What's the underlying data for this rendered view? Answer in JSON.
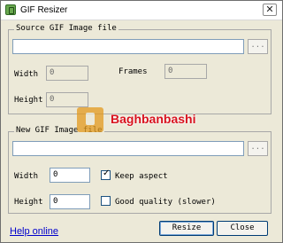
{
  "window": {
    "title": "GIF Resizer",
    "close_glyph": "✕"
  },
  "source_group": {
    "title": "Source GIF Image file",
    "path_value": "",
    "browse_label": "...",
    "width_label": "Width",
    "width_value": "0",
    "height_label": "Height",
    "height_value": "0",
    "frames_label": "Frames",
    "frames_value": "0"
  },
  "new_group": {
    "title": "New GIF Image file",
    "path_value": "",
    "browse_label": "...",
    "width_label": "Width",
    "width_value": "0",
    "height_label": "Height",
    "height_value": "0",
    "keep_aspect_label": "Keep aspect",
    "keep_aspect_checked": true,
    "check_glyph": "✓",
    "good_quality_label": "Good quality (slower)",
    "good_quality_checked": false
  },
  "buttons": {
    "resize": "Resize",
    "close": "Close"
  },
  "help_link": "Help online",
  "watermark": {
    "text": "Baghbanbashi"
  }
}
